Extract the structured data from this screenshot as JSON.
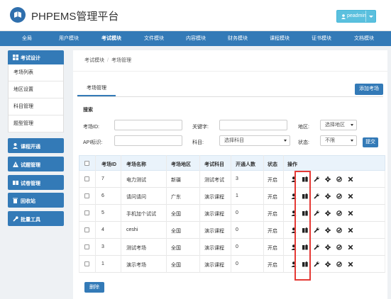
{
  "header": {
    "site_title": "PHPEMS管理平台",
    "user_name": "peadmin"
  },
  "topnav": {
    "items": [
      "全局",
      "用户模块",
      "考试模块",
      "文件模块",
      "内容模块",
      "财务模块",
      "课程模块",
      "证书模块",
      "文档模块"
    ],
    "active_index": 2
  },
  "sidebar": {
    "group_title": "考试设计",
    "sub_items": [
      "考场列表",
      "地区设置",
      "科目管理",
      "题型管理"
    ],
    "buttons": [
      "课程开通",
      "试题管理",
      "试卷管理",
      "回收站",
      "批量工具"
    ]
  },
  "breadcrumb": {
    "items": [
      "考试模块",
      "考场管理"
    ],
    "separator": "/"
  },
  "tabs": {
    "active": "考场管理"
  },
  "add_button": "添加考场",
  "search": {
    "title": "搜索",
    "room_id_label": "考场ID:",
    "keyword_label": "关键字:",
    "region_label": "地区:",
    "region_value": "选择地区",
    "api_label": "API标识:",
    "subject_label": "科目:",
    "subject_value": "选择科目",
    "status_label": "状态:",
    "status_value": "不限",
    "submit_label": "提交"
  },
  "table": {
    "headers": [
      "考场ID",
      "考场名称",
      "考场地区",
      "考试科目",
      "开通人数",
      "状态",
      "操作"
    ],
    "rows": [
      {
        "id": "7",
        "name": "电力测试",
        "region": "新疆",
        "subject": "测试考试",
        "count": "3",
        "status": "开启"
      },
      {
        "id": "6",
        "name": "请问请问",
        "region": "广东",
        "subject": "演示课程",
        "count": "1",
        "status": "开启"
      },
      {
        "id": "5",
        "name": "手机加个试试",
        "region": "全国",
        "subject": "演示课程",
        "count": "0",
        "status": "开启"
      },
      {
        "id": "4",
        "name": "ceshi",
        "region": "全国",
        "subject": "演示课程",
        "count": "0",
        "status": "开启"
      },
      {
        "id": "3",
        "name": "测试考场",
        "region": "全国",
        "subject": "演示课程",
        "count": "0",
        "status": "开启"
      },
      {
        "id": "1",
        "name": "演示考场",
        "region": "全国",
        "subject": "演示课程",
        "count": "0",
        "status": "开启"
      }
    ],
    "action_icons": [
      "user-icon",
      "book-icon",
      "wrench-icon",
      "gear-icon",
      "check-circle-icon",
      "delete-x-icon"
    ]
  },
  "delete_button": "删除",
  "colors": {
    "primary": "#337ab7",
    "user_button": "#5bc0de",
    "highlight": "#e53935"
  }
}
